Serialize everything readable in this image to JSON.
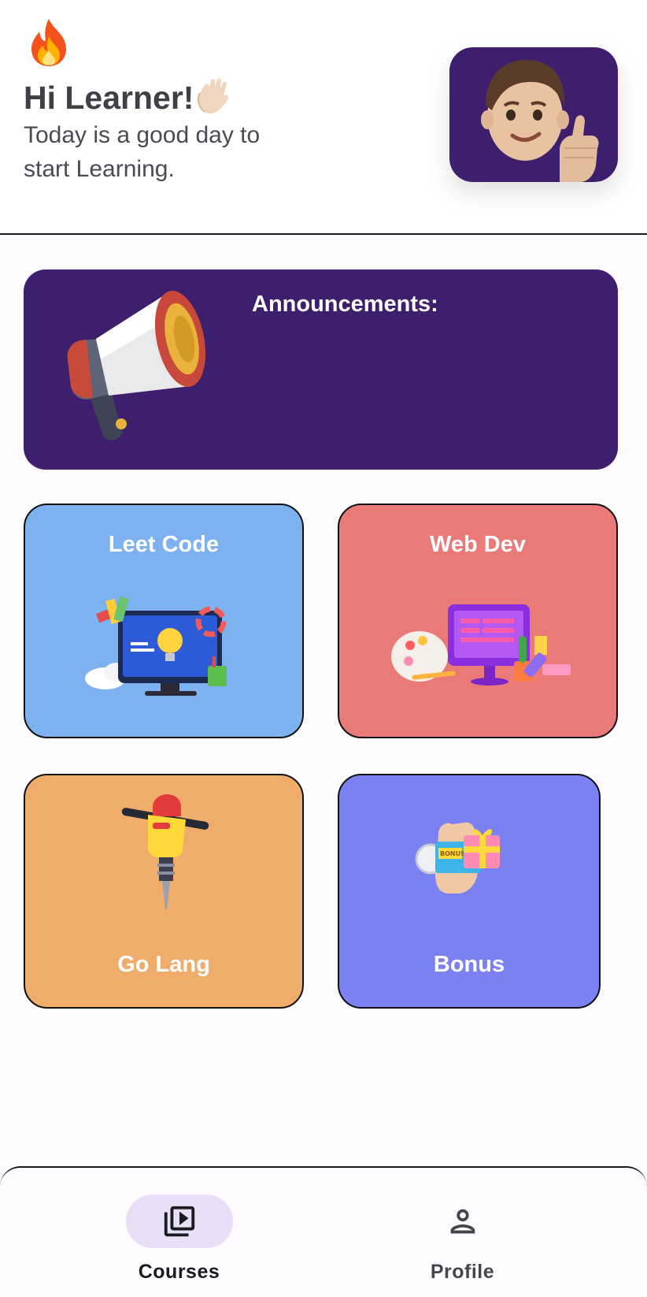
{
  "header": {
    "greeting": "Hi Learner!",
    "subtitle": "Today is a good day to start Learning."
  },
  "announcements": {
    "title": "Announcements:"
  },
  "courses": [
    {
      "title": "Leet Code",
      "color": "#7eb1f0"
    },
    {
      "title": "Web Dev",
      "color": "#ea7a78"
    },
    {
      "title": "Go Lang",
      "color": "#efac6a"
    },
    {
      "title": "Bonus",
      "color": "#7b80f3"
    }
  ],
  "nav": {
    "items": [
      {
        "label": "Courses",
        "icon": "video-library-icon",
        "active": true
      },
      {
        "label": "Profile",
        "icon": "person-icon",
        "active": false
      }
    ]
  },
  "colors": {
    "accent": "#3d1f6e",
    "nav_active_pill": "#e7dff6"
  }
}
